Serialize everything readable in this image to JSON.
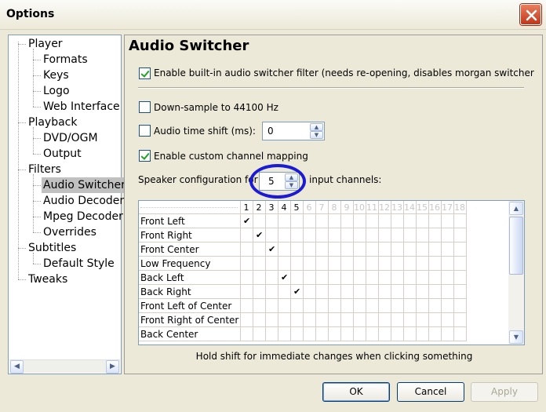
{
  "window": {
    "title": "Options"
  },
  "tree": {
    "items": [
      {
        "label": "Player",
        "level": 0
      },
      {
        "label": "Formats",
        "level": 1
      },
      {
        "label": "Keys",
        "level": 1
      },
      {
        "label": "Logo",
        "level": 1
      },
      {
        "label": "Web Interface",
        "level": 1
      },
      {
        "label": "Playback",
        "level": 0
      },
      {
        "label": "DVD/OGM",
        "level": 1
      },
      {
        "label": "Output",
        "level": 1
      },
      {
        "label": "Filters",
        "level": 0
      },
      {
        "label": "Audio Switcher",
        "level": 1,
        "selected": true
      },
      {
        "label": "Audio Decoders",
        "level": 1
      },
      {
        "label": "Mpeg Decoder",
        "level": 1
      },
      {
        "label": "Overrides",
        "level": 1
      },
      {
        "label": "Subtitles",
        "level": 0
      },
      {
        "label": "Default Style",
        "level": 1
      },
      {
        "label": "Tweaks",
        "level": 0
      }
    ]
  },
  "panel": {
    "title": "Audio Switcher",
    "enable_filter": {
      "label": "Enable built-in audio switcher filter (needs re-opening, disables morgan switcher",
      "checked": true
    },
    "downsample": {
      "label": "Down-sample to 44100 Hz",
      "checked": false
    },
    "time_shift": {
      "label": "Audio time shift (ms):",
      "checked": false,
      "value": "0"
    },
    "custom_mapping": {
      "label": "Enable custom channel mapping",
      "checked": true
    },
    "speaker_config": {
      "prefix": "Speaker configuration for",
      "value": "5",
      "suffix": "input channels:"
    },
    "grid": {
      "columns": [
        "1",
        "2",
        "3",
        "4",
        "5",
        "6",
        "7",
        "8",
        "9",
        "10",
        "11",
        "12",
        "13",
        "14",
        "15",
        "16",
        "17",
        "18"
      ],
      "active_columns": 5,
      "rows": [
        {
          "label": "Front Left",
          "check": 1
        },
        {
          "label": "Front Right",
          "check": 2
        },
        {
          "label": "Front Center",
          "check": 3
        },
        {
          "label": "Low Frequency",
          "check": 0
        },
        {
          "label": "Back Left",
          "check": 4
        },
        {
          "label": "Back Right",
          "check": 5
        },
        {
          "label": "Front Left of Center",
          "check": 0
        },
        {
          "label": "Front Right of Center",
          "check": 0
        },
        {
          "label": "Back Center",
          "check": 0
        }
      ]
    },
    "hint": "Hold shift for immediate changes when clicking something"
  },
  "buttons": {
    "ok": "OK",
    "cancel": "Cancel",
    "apply": "Apply"
  },
  "colors": {
    "highlight_circle": "#1b1bd6",
    "check_green": "#21a121"
  }
}
